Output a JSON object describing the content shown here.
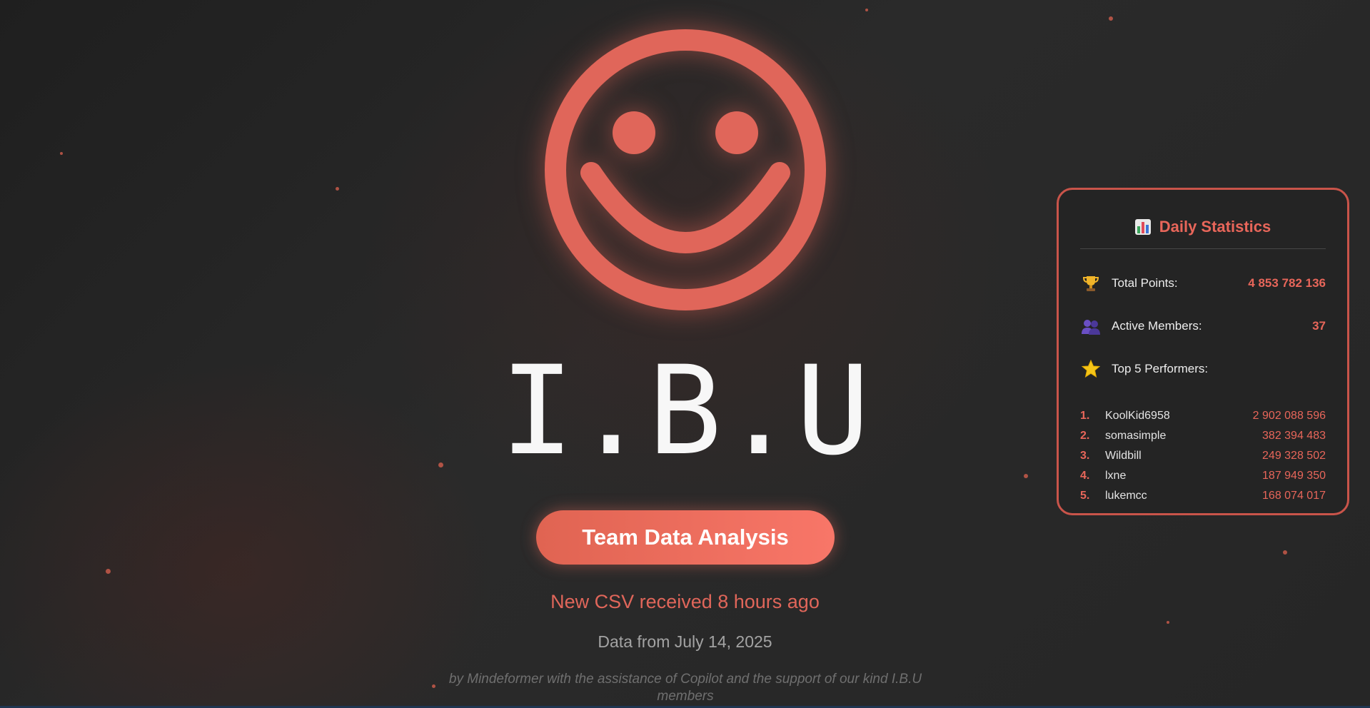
{
  "app": {
    "title": "I.B.U",
    "cta_label": "Team Data Analysis",
    "status": "New CSV received 8 hours ago",
    "data_date": "Data from July 14, 2025",
    "credit": "by Mindeformer with the assistance of Copilot and the support of our kind I.B.U members",
    "logo_icon": "smiley-face-icon",
    "accent_color": "#e0665a"
  },
  "stats": {
    "title": "Daily Statistics",
    "title_icon": "bar-chart-icon",
    "rows": [
      {
        "icon": "trophy-icon",
        "label": "Total Points:",
        "value": "4 853 782 136"
      },
      {
        "icon": "people-icon",
        "label": "Active Members:",
        "value": "37"
      },
      {
        "icon": "star-icon",
        "label": "Top 5 Performers:",
        "value": ""
      }
    ],
    "performers": [
      {
        "rank": "1.",
        "name": "KoolKid6958",
        "points": "2 902 088 596"
      },
      {
        "rank": "2.",
        "name": "somasimple",
        "points": "382 394 483"
      },
      {
        "rank": "3.",
        "name": "Wildbill",
        "points": "249 328 502"
      },
      {
        "rank": "4.",
        "name": "lxne",
        "points": "187 949 350"
      },
      {
        "rank": "5.",
        "name": "lukemcc",
        "points": "168 074 017"
      }
    ]
  }
}
